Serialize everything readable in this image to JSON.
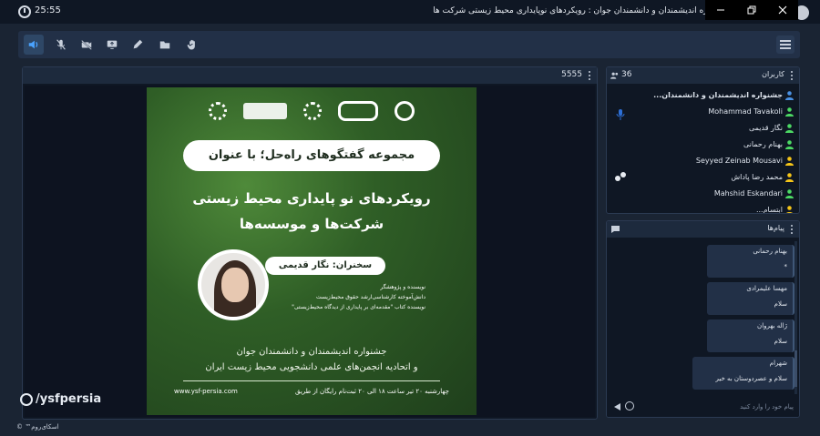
{
  "titlebar": {
    "time": "25:55",
    "title": "جشنواره اندیشمندان و دانشمندان جوان : رویکردهای نوپایداری محیط زیستی شرکت ها"
  },
  "toolbar": {
    "items": [
      "speaker-icon",
      "mic-off-icon",
      "camera-off-icon",
      "screen-share-icon",
      "pen-icon",
      "folder-icon",
      "hand-icon"
    ],
    "menu": "menu-icon"
  },
  "video": {
    "label": "5555"
  },
  "poster": {
    "series_title": "مجموعه گفتگوهای راه‌حل؛ با عنوان",
    "headline_1": "رویکردهای نو پایداری محیط زیستی",
    "headline_2": "شرکت‌ها و موسسه‌ها",
    "speaker_label": "سخنران: نگار قدیمی",
    "bio_1": "نویسنده و پژوهشگر",
    "bio_2": "دانش‌آموخته کارشناسی‌ارشد حقوق محیط‌زیست",
    "bio_3": "نویسنده کتاب \"مقدمه‌ای بر پایداری از دیدگاه محیط‌زیستی\"",
    "fest_1": "جشنواره اندیشمندان و دانشمندان جوان",
    "fest_2": "و اتحادیه انجمن‌های علمی دانشجویی محیط زیست ایران",
    "footer_right": "چهارشنبه ۲۰ تیر ساعت ۱۸ الی ۲۰    ثبت‌نام رایگان از طریق",
    "footer_left": "www.ysf-persia.com"
  },
  "watermark": "/ysfpersia",
  "users": {
    "title": "کاربران",
    "count": "36",
    "list": [
      {
        "name": "جشنواره اندیشمندان و دانشمندان...",
        "color": "#4a90e2"
      },
      {
        "name": "Mohammad Tavakoli",
        "color": "#4cd964"
      },
      {
        "name": "نگار قدیمی",
        "color": "#4cd964"
      },
      {
        "name": "بهنام رحمانی",
        "color": "#4cd964"
      },
      {
        "name": "Seyyed Zeinab Mousavi",
        "color": "#f5c518"
      },
      {
        "name": "محمد رضا پاداش",
        "color": "#f5c518"
      },
      {
        "name": "Mahshid Eskandari",
        "color": "#4cd964"
      },
      {
        "name": "ابتسام...",
        "color": "#f5c518"
      }
    ]
  },
  "messages": {
    "title": "پیام‌ها",
    "list": [
      {
        "name": "بهنام رحمانی",
        "text": "*"
      },
      {
        "name": "مهسا علیمرادی",
        "text": "سلام"
      },
      {
        "name": "ژاله بهروان",
        "text": "سلام"
      },
      {
        "name": "شهرام",
        "text": "سلام و عصردوستان به خیر"
      }
    ],
    "placeholder": "پیام خود را وارد کنید"
  },
  "copyright": "اسکای‌روم™ ©"
}
